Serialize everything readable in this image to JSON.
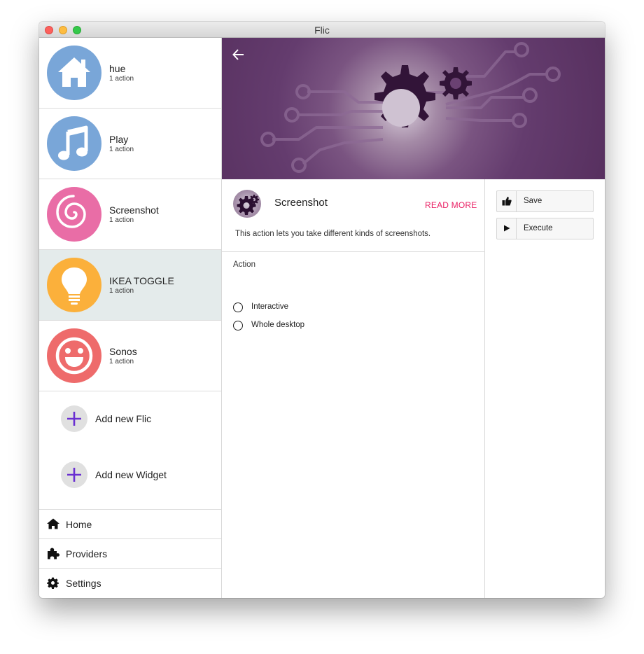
{
  "window": {
    "title": "Flic"
  },
  "sidebar": {
    "flics": [
      {
        "name": "hue",
        "count": "1 action",
        "color": "#79a6d8",
        "icon": "house-icon"
      },
      {
        "name": "Play",
        "count": "1 action",
        "color": "#79a6d8",
        "icon": "music-note-icon"
      },
      {
        "name": "Screenshot",
        "count": "1 action",
        "color": "#e96da6",
        "icon": "spiral-icon"
      },
      {
        "name": "IKEA TOGGLE",
        "count": "1 action",
        "color": "#fbb03b",
        "icon": "lightbulb-icon"
      },
      {
        "name": "Sonos",
        "count": "1 action",
        "color": "#ee6b6b",
        "icon": "smiley-icon"
      }
    ],
    "add_flic_label": "Add new Flic",
    "add_widget_label": "Add new Widget",
    "nav": [
      {
        "label": "Home",
        "icon": "home-icon"
      },
      {
        "label": "Providers",
        "icon": "puzzle-icon"
      },
      {
        "label": "Settings",
        "icon": "gear-icon"
      }
    ]
  },
  "detail": {
    "action_title": "Screenshot",
    "read_more": "READ MORE",
    "description": "This action lets you take different kinds of screenshots.",
    "section_label": "Action",
    "options": [
      "Interactive",
      "Whole desktop"
    ]
  },
  "buttons": {
    "save": "Save",
    "execute": "Execute"
  },
  "colors": {
    "accent_pink": "#e91e63",
    "accent_purple": "#6a2fd1",
    "hero_purple": "#57305f",
    "selected_bg": "#e4ebeb"
  }
}
